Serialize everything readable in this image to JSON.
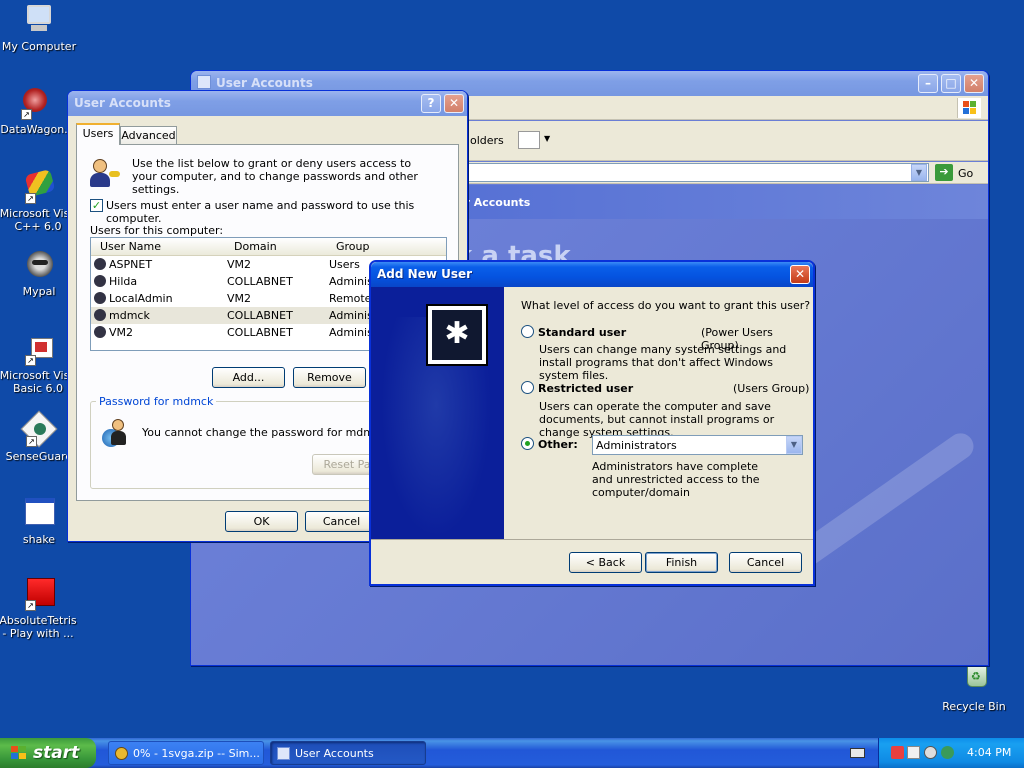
{
  "desktop": {
    "icons": [
      {
        "label": "My Computer"
      },
      {
        "label": "DataWagon."
      },
      {
        "label": "Microsoft Visu C++ 6.0"
      },
      {
        "label": "Mypal"
      },
      {
        "label": "Microsoft Visu Basic 6.0"
      },
      {
        "label": "SenseGuard"
      },
      {
        "label": "shake"
      },
      {
        "label": "AbsoluteTetris - Play with ..."
      },
      {
        "label": "Recycle Bin"
      }
    ]
  },
  "bg_window": {
    "title": "User Accounts",
    "toolbar_folders": "olders",
    "go_label": "Go",
    "panel_title": "er Accounts",
    "pick_task": "k a task"
  },
  "ua_dialog": {
    "title": "User Accounts",
    "tabs": [
      "Users",
      "Advanced"
    ],
    "intro": "Use the list below to grant or deny users access to your computer, and to change passwords and other settings.",
    "checkbox_label": "Users must enter a user name and password to use this computer.",
    "users_label": "Users for this computer:",
    "columns": [
      "User Name",
      "Domain",
      "Group"
    ],
    "rows": [
      {
        "name": "ASPNET",
        "domain": "VM2",
        "group": "Users"
      },
      {
        "name": "Hilda",
        "domain": "COLLABNET",
        "group": "Adminis"
      },
      {
        "name": "LocalAdmin",
        "domain": "VM2",
        "group": "Remote"
      },
      {
        "name": "mdmck",
        "domain": "COLLABNET",
        "group": "Adminis"
      },
      {
        "name": "VM2",
        "domain": "COLLABNET",
        "group": "Adminis"
      }
    ],
    "add_label": "Add...",
    "remove_label": "Remove",
    "password_group": "Password for mdmck",
    "password_text": "You cannot change the password for mdmck.",
    "reset_label": "Reset Pa",
    "ok_label": "OK",
    "cancel_label": "Cancel"
  },
  "new_user": {
    "title": "Add New User",
    "question": "What level of access do you want to grant this user?",
    "standard_label": "Standard user",
    "standard_group": "(Power Users Group)",
    "standard_desc": "Users can change many system settings and install programs that don't affect Windows system files.",
    "restricted_label": "Restricted user",
    "restricted_group": "(Users Group)",
    "restricted_desc": "Users can operate the computer and save documents, but cannot install programs or change system settings.",
    "other_label": "Other:",
    "other_value": "Administrators",
    "other_desc": "Administrators have complete and unrestricted access to the computer/domain",
    "back_label": "< Back",
    "finish_label": "Finish",
    "cancel_label": "Cancel"
  },
  "taskbar": {
    "start_label": "start",
    "tasks": [
      "0% - 1svga.zip -- Sim...",
      "User Accounts"
    ],
    "clock": "4:04 PM"
  }
}
